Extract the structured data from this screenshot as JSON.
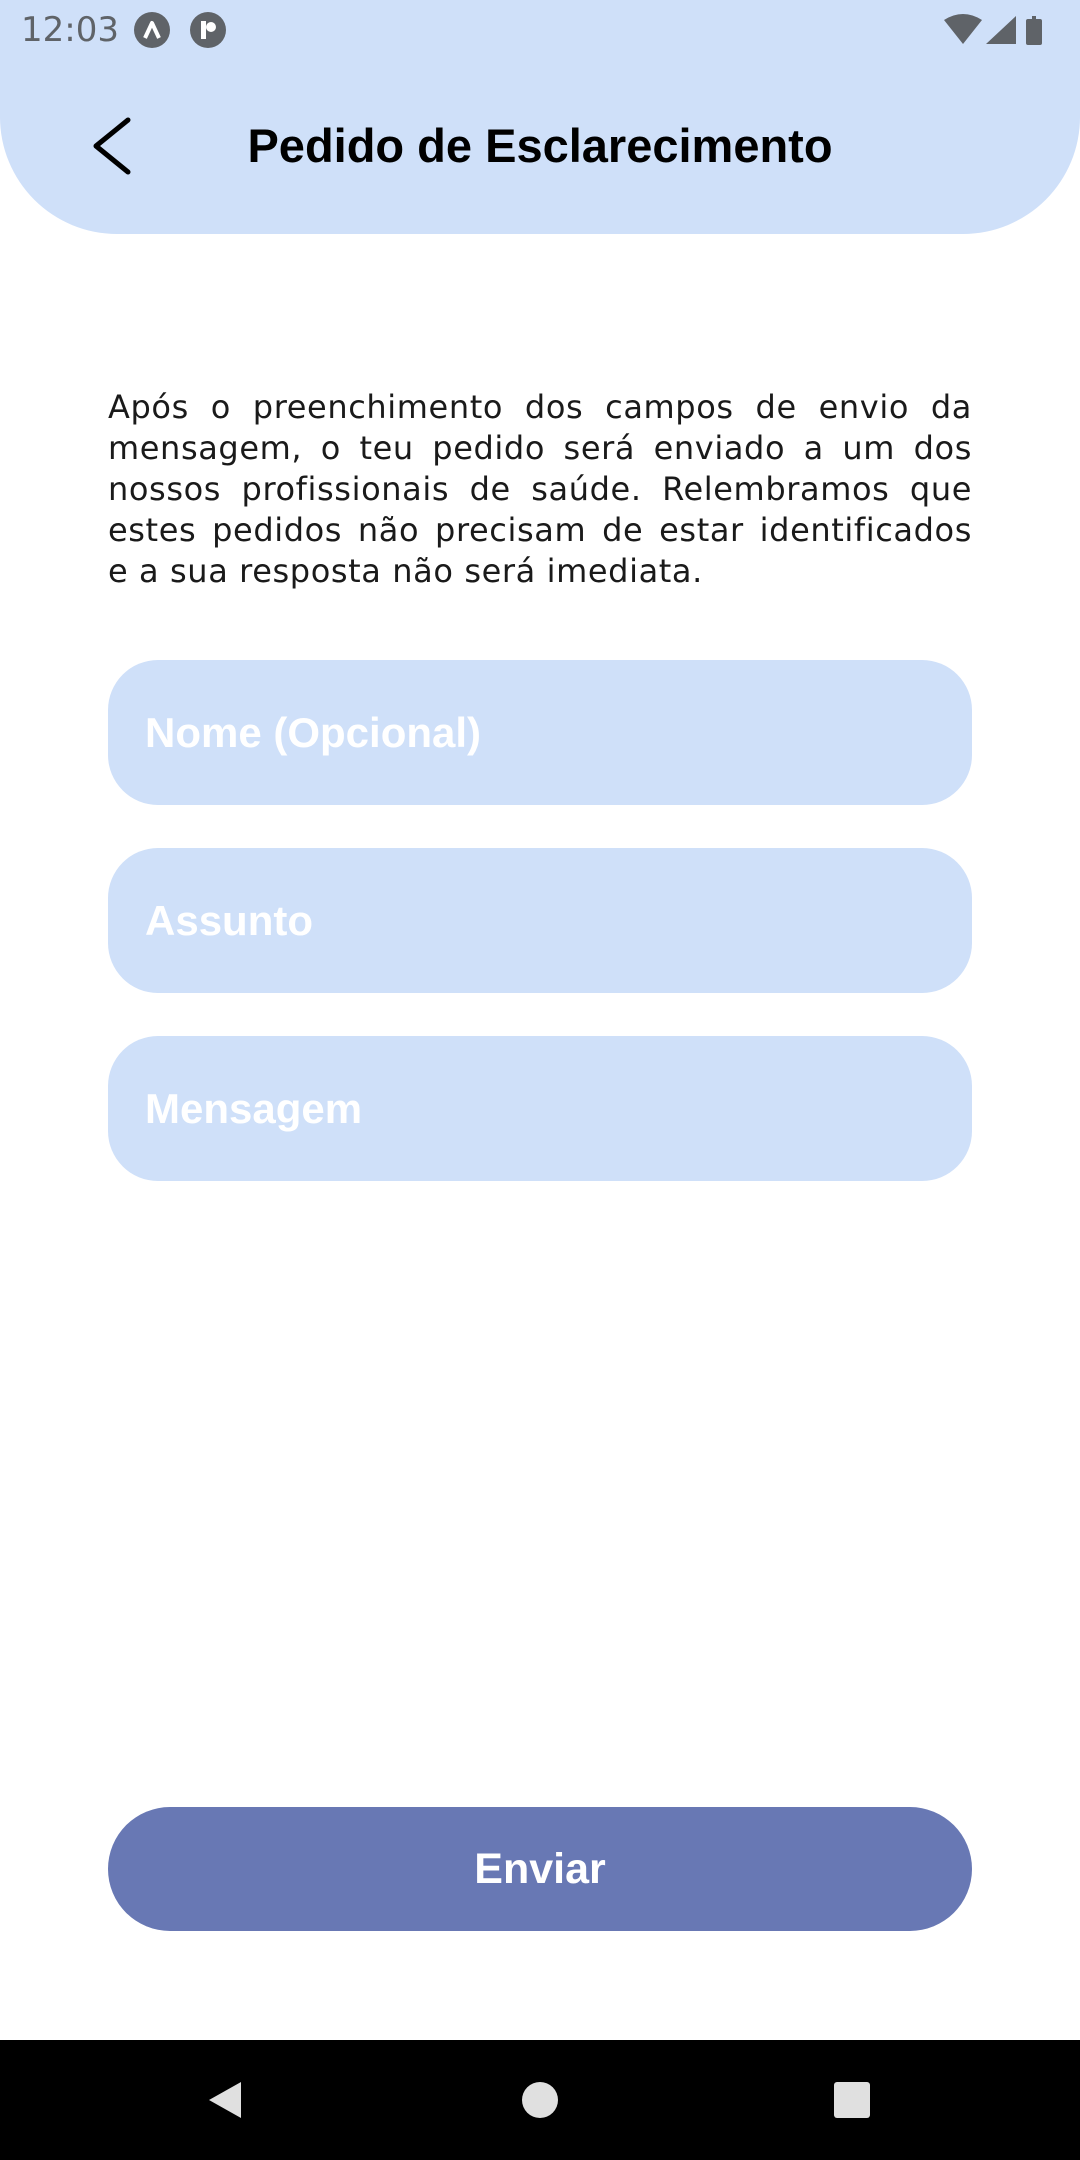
{
  "status_bar": {
    "time": "12:03",
    "icons": [
      "app-a-icon",
      "app-p-icon",
      "wifi-icon",
      "signal-icon",
      "battery-icon"
    ]
  },
  "header": {
    "back_icon": "chevron-left-icon",
    "title": "Pedido de Esclarecimento"
  },
  "intro": {
    "text": "Após o preenchimento dos campos de envio da mensagem, o teu pedido será enviado a um dos nossos profissionais de saúde. Relembramos que estes pedidos não precisam de estar identificados e a sua resposta não será imediata."
  },
  "form": {
    "name_placeholder": "Nome (Opcional)",
    "name_value": "",
    "subject_placeholder": "Assunto",
    "subject_value": "",
    "message_placeholder": "Mensagem",
    "message_value": "",
    "submit_label": "Enviar"
  },
  "colors": {
    "header_bg": "#cfe0f9",
    "field_bg": "#cfe0f9",
    "button_bg": "#6878b4",
    "placeholder": "#ffffff"
  },
  "nav_bar": {
    "buttons": [
      "nav-back-icon",
      "nav-home-icon",
      "nav-recents-icon"
    ]
  }
}
